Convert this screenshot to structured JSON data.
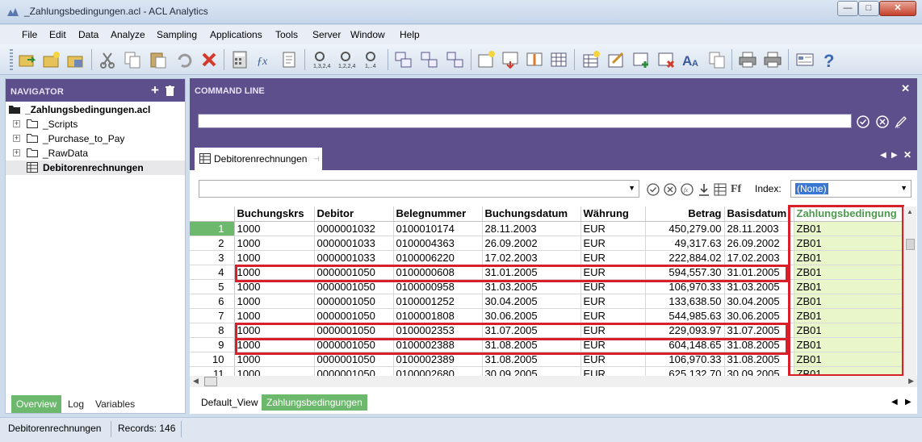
{
  "window": {
    "title": "_Zahlungsbedingungen.acl - ACL Analytics",
    "minimize": "—",
    "maximize": "□",
    "close": "✕"
  },
  "menu": [
    "File",
    "Edit",
    "Data",
    "Analyze",
    "Sampling",
    "Applications",
    "Tools",
    "Server",
    "Window",
    "Help"
  ],
  "toolbar_icons": [
    "open-project-icon",
    "new-project-icon",
    "save-project-icon",
    "cut-icon",
    "copy-icon",
    "paste-icon",
    "undo-icon",
    "delete-icon",
    "calculator-icon",
    "function-icon",
    "notes-icon",
    "filter-icon",
    "filter-next-icon",
    "filter-prev-icon",
    "table-history-icon",
    "relations-icon",
    "join-icon",
    "new-view-icon",
    "add-column-icon",
    "remove-column-icon",
    "table-layout-icon",
    "insert-icon",
    "edit-icon",
    "add-row-icon",
    "delete-row-icon",
    "font-icon",
    "copy-view-icon",
    "print-icon",
    "print-preview-icon",
    "properties-icon",
    "help-icon"
  ],
  "navigator": {
    "title": "NAVIGATOR",
    "project": "_Zahlungsbedingungen.acl",
    "items": [
      {
        "label": "_Scripts"
      },
      {
        "label": "_Purchase_to_Pay"
      },
      {
        "label": "_RawData"
      },
      {
        "label": "Debitorenrechnungen"
      }
    ],
    "tabs": [
      "Overview",
      "Log",
      "Variables"
    ]
  },
  "command_line": {
    "title": "COMMAND LINE",
    "value": ""
  },
  "view": {
    "tab_label": "Debitorenrechnungen",
    "filter_value": "",
    "index_label": "Index:",
    "index_value": "(None)",
    "columns": [
      "Buchungskrs",
      "Debitor",
      "Belegnummer",
      "Buchungsdatum",
      "Währung",
      "Betrag",
      "Basisdatum",
      "Zahlungsbedingung"
    ],
    "rows": [
      [
        "1",
        "1000",
        "0000001032",
        "0100010174",
        "28.11.2003",
        "EUR",
        "450,279.00",
        "28.11.2003",
        "ZB01"
      ],
      [
        "2",
        "1000",
        "0000001033",
        "0100004363",
        "26.09.2002",
        "EUR",
        "49,317.63",
        "26.09.2002",
        "ZB01"
      ],
      [
        "3",
        "1000",
        "0000001033",
        "0100006220",
        "17.02.2003",
        "EUR",
        "222,884.02",
        "17.02.2003",
        "ZB01"
      ],
      [
        "4",
        "1000",
        "0000001050",
        "0100000608",
        "31.01.2005",
        "EUR",
        "594,557.30",
        "31.01.2005",
        "ZB01"
      ],
      [
        "5",
        "1000",
        "0000001050",
        "0100000958",
        "31.03.2005",
        "EUR",
        "106,970.33",
        "31.03.2005",
        "ZB01"
      ],
      [
        "6",
        "1000",
        "0000001050",
        "0100001252",
        "30.04.2005",
        "EUR",
        "133,638.50",
        "30.04.2005",
        "ZB01"
      ],
      [
        "7",
        "1000",
        "0000001050",
        "0100001808",
        "30.06.2005",
        "EUR",
        "544,985.63",
        "30.06.2005",
        "ZB01"
      ],
      [
        "8",
        "1000",
        "0000001050",
        "0100002353",
        "31.07.2005",
        "EUR",
        "229,093.97",
        "31.07.2005",
        "ZB01"
      ],
      [
        "9",
        "1000",
        "0000001050",
        "0100002388",
        "31.08.2005",
        "EUR",
        "604,148.65",
        "31.08.2005",
        "ZB01"
      ],
      [
        "10",
        "1000",
        "0000001050",
        "0100002389",
        "31.08.2005",
        "EUR",
        "106,970.33",
        "31.08.2005",
        "ZB01"
      ],
      [
        "11",
        "1000",
        "0000001050",
        "0100002680",
        "30.09.2005",
        "EUR",
        "625,132.70",
        "30.09.2005",
        "ZB01"
      ]
    ],
    "view_tabs": [
      "Default_View",
      "Zahlungsbedingungen"
    ]
  },
  "status": {
    "table": "Debitorenrechnungen",
    "records": "Records: 146"
  },
  "colors": {
    "purple_header": "#5d4f8c",
    "green_accent": "#6cb86c",
    "highlight_red": "#d8202a",
    "highlight_column": "#e8f6c9"
  }
}
